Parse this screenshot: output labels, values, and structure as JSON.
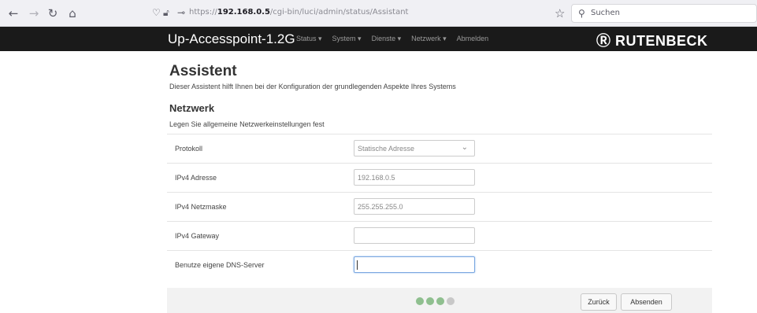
{
  "browser": {
    "url_prefix": "https://",
    "url_host": "192.168.0.5",
    "url_path": "/cgi-bin/luci/admin/status/Assistant",
    "search_placeholder": "Suchen"
  },
  "header": {
    "title": "Up-Accesspoint-1.2G",
    "menu": [
      "Status ▾",
      "System ▾",
      "Dienste ▾",
      "Netzwerk ▾",
      "Abmelden"
    ],
    "brand": "Ⓡ RUTENBECK"
  },
  "page": {
    "heading": "Assistent",
    "intro": "Dieser Assistent hilft Ihnen bei der Konfiguration der grundlegenden Aspekte Ihres Systems",
    "section_title": "Netzwerk",
    "section_desc": "Legen Sie allgemeine Netzwerkeinstellungen fest"
  },
  "form": {
    "protocol_label": "Protokoll",
    "protocol_value": "Statische Adresse",
    "ipv4_address_label": "IPv4 Adresse",
    "ipv4_address_value": "192.168.0.5",
    "ipv4_netmask_label": "IPv4 Netzmaske",
    "ipv4_netmask_value": "255.255.255.0",
    "ipv4_gateway_label": "IPv4 Gateway",
    "ipv4_gateway_value": "",
    "dns_label": "Benutze eigene DNS-Server",
    "dns_value": ""
  },
  "wizard": {
    "step_current": 3,
    "step_total": 4,
    "back_label": "Zurück",
    "submit_label": "Absenden"
  }
}
